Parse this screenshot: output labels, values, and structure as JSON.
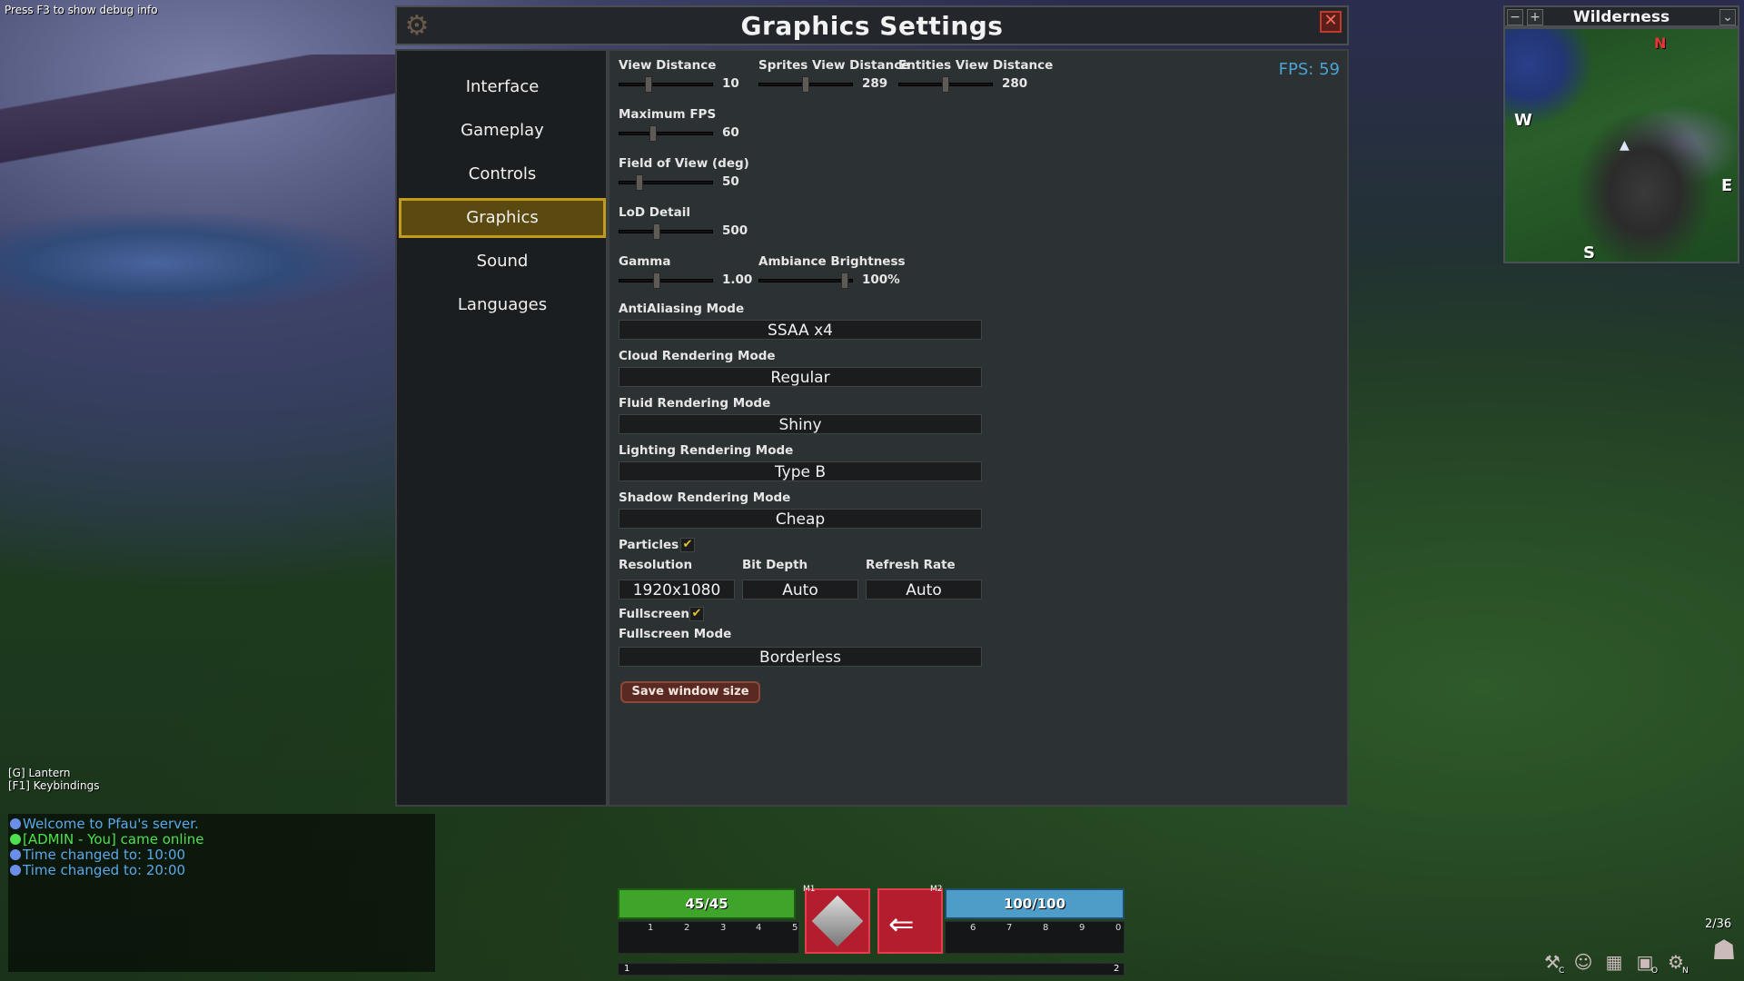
{
  "debug_hint": "Press F3 to show debug info",
  "window": {
    "title": "Graphics Settings",
    "fps": "FPS: 59",
    "tabs": [
      "Interface",
      "Gameplay",
      "Controls",
      "Graphics",
      "Sound",
      "Languages"
    ],
    "active_tab": "Graphics"
  },
  "settings": {
    "view_distance": {
      "label": "View Distance",
      "value": "10",
      "level": 0.3
    },
    "sprites_view_distance": {
      "label": "Sprites View Distance",
      "value": "289",
      "level": 0.5
    },
    "entities_view_distance": {
      "label": "Entities View Distance",
      "value": "280",
      "level": 0.5
    },
    "max_fps": {
      "label": "Maximum FPS",
      "value": "60",
      "level": 0.35
    },
    "fov": {
      "label": "Field of View (deg)",
      "value": "50",
      "level": 0.2
    },
    "lod": {
      "label": "LoD Detail",
      "value": "500",
      "level": 0.4
    },
    "gamma": {
      "label": "Gamma",
      "value": "1.00",
      "level": 0.4
    },
    "ambiance": {
      "label": "Ambiance Brightness",
      "value": "100%",
      "level": 0.95
    },
    "aa": {
      "label": "AntiAliasing Mode",
      "value": "SSAA x4"
    },
    "cloud": {
      "label": "Cloud Rendering Mode",
      "value": "Regular"
    },
    "fluid": {
      "label": "Fluid Rendering Mode",
      "value": "Shiny"
    },
    "lighting": {
      "label": "Lighting Rendering Mode",
      "value": "Type B"
    },
    "shadow": {
      "label": "Shadow Rendering Mode",
      "value": "Cheap"
    },
    "particles": {
      "label": "Particles",
      "checked": true
    },
    "resolution": {
      "label": "Resolution",
      "value": "1920x1080"
    },
    "bit_depth": {
      "label": "Bit Depth",
      "value": "Auto"
    },
    "refresh_rate": {
      "label": "Refresh Rate",
      "value": "Auto"
    },
    "fullscreen": {
      "label": "Fullscreen",
      "checked": true
    },
    "fullscreen_mode": {
      "label": "Fullscreen Mode",
      "value": "Borderless"
    },
    "save_button": "Save window size"
  },
  "minimap": {
    "title": "Wilderness",
    "minus": "−",
    "plus": "+",
    "collapse": "⌄",
    "n": "N",
    "s": "S",
    "e": "E",
    "w": "W"
  },
  "hints": [
    "[G] Lantern",
    "[F1] Keybindings"
  ],
  "chat": [
    {
      "text": "Welcome to Pfau's server.",
      "color": "#5ba8e8"
    },
    {
      "text": "[ADMIN - You] came online",
      "color": "#4fe04f"
    },
    {
      "text": "Time changed to: 10:00",
      "color": "#5ba8e8"
    },
    {
      "text": "Time changed to: 20:00",
      "color": "#5ba8e8"
    }
  ],
  "hotbar": {
    "health": "45/45",
    "energy": "100/100",
    "m1": "M1",
    "m2": "M2",
    "slots_left": [
      "1",
      "2",
      "3",
      "4",
      "5"
    ],
    "slots_right": [
      "6",
      "7",
      "8",
      "9",
      "0"
    ],
    "xp_left": "1",
    "xp_right": "2"
  },
  "page_counter": "2/36",
  "tray": {
    "c": "C",
    "o": "O",
    "n": "N"
  }
}
